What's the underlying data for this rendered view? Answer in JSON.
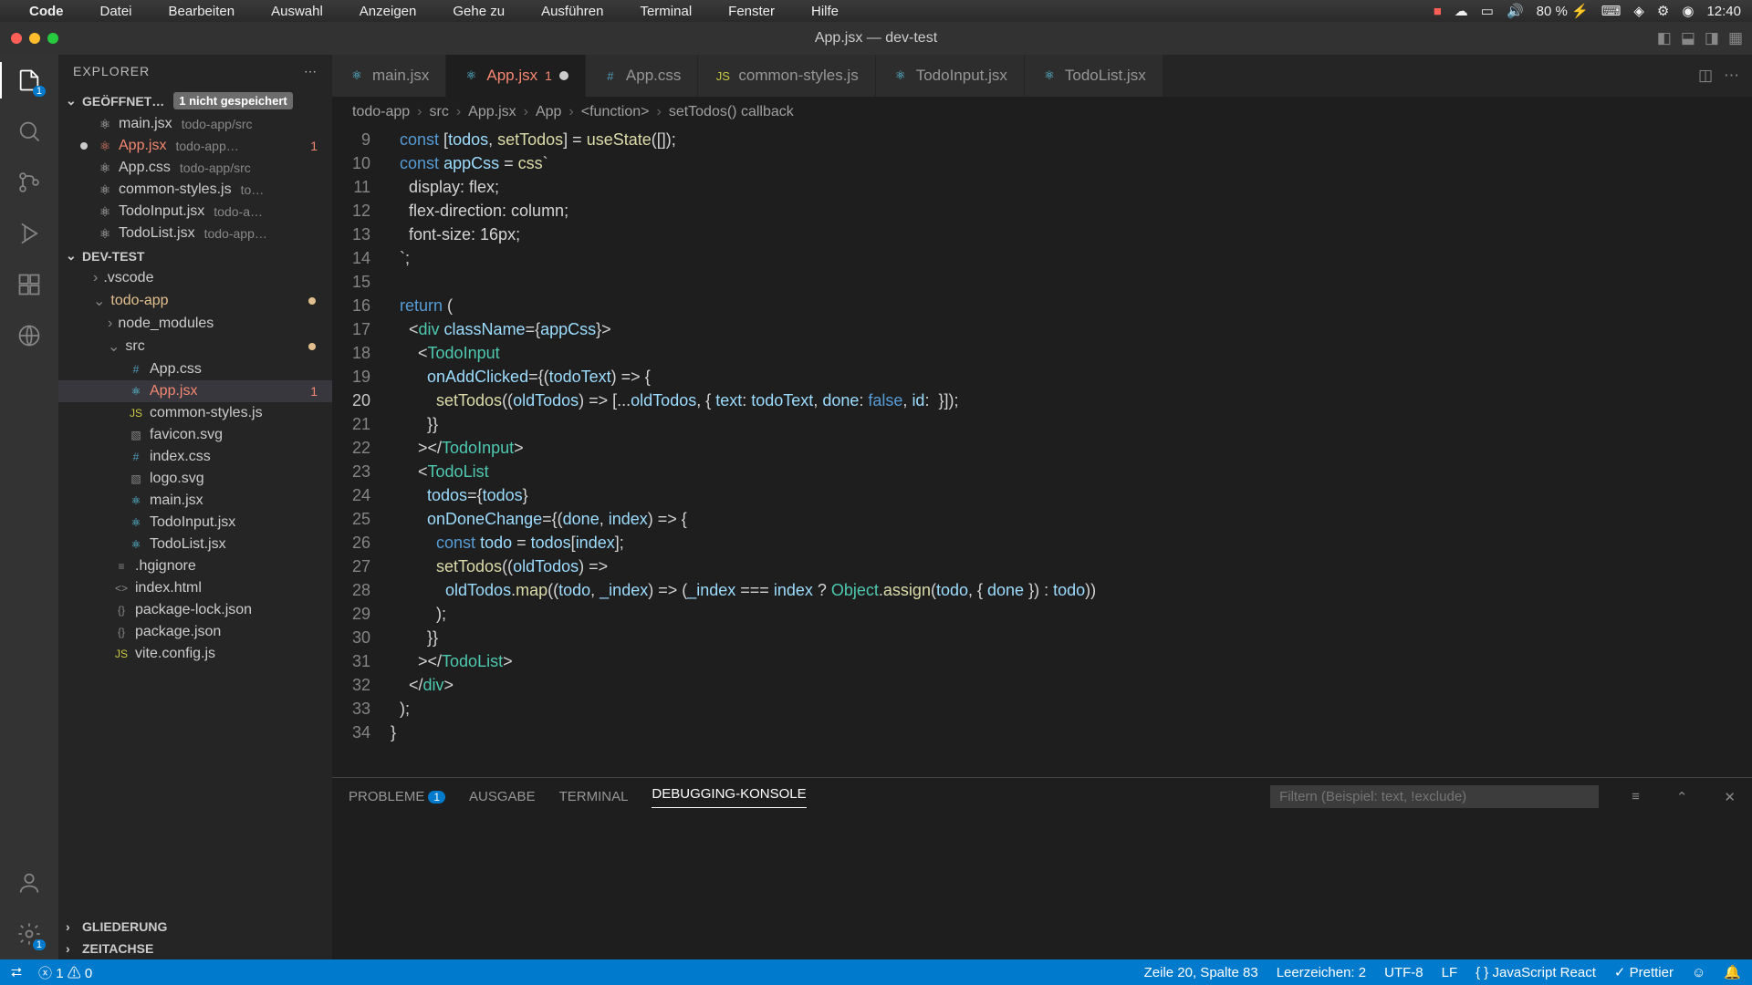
{
  "mac_menu": [
    "Code",
    "Datei",
    "Bearbeiten",
    "Auswahl",
    "Anzeigen",
    "Gehe zu",
    "Ausführen",
    "Terminal",
    "Fenster",
    "Hilfe"
  ],
  "mac_right": {
    "battery": "80 % ⚡",
    "time": "12:40"
  },
  "window_title": "App.jsx — dev-test",
  "explorer_title": "EXPLORER",
  "open_editors": {
    "label": "GEÖFFNET…",
    "unsaved": "1 nicht gespeichert"
  },
  "open_files": [
    {
      "name": "main.jsx",
      "dim": "todo-app/src"
    },
    {
      "name": "App.jsx",
      "dim": "todo-app…",
      "err": "1",
      "mod": true
    },
    {
      "name": "App.css",
      "dim": "todo-app/src"
    },
    {
      "name": "common-styles.js",
      "dim": "to…"
    },
    {
      "name": "TodoInput.jsx",
      "dim": "todo-a…"
    },
    {
      "name": "TodoList.jsx",
      "dim": "todo-app…"
    }
  ],
  "proj_name": "DEV-TEST",
  "tree": [
    {
      "n": ".vscode",
      "d": 1,
      "folder": true
    },
    {
      "n": "todo-app",
      "d": 1,
      "folder": true,
      "open": true,
      "mod": true
    },
    {
      "n": "node_modules",
      "d": 2,
      "folder": true
    },
    {
      "n": "src",
      "d": 2,
      "folder": true,
      "open": true,
      "mod": true
    },
    {
      "n": "App.css",
      "d": 3,
      "ic": "#"
    },
    {
      "n": "App.jsx",
      "d": 3,
      "ic": "⚛",
      "err": "1",
      "sel": true
    },
    {
      "n": "common-styles.js",
      "d": 3,
      "ic": "JS"
    },
    {
      "n": "favicon.svg",
      "d": 3,
      "ic": "▧"
    },
    {
      "n": "index.css",
      "d": 3,
      "ic": "#"
    },
    {
      "n": "logo.svg",
      "d": 3,
      "ic": "▧"
    },
    {
      "n": "main.jsx",
      "d": 3,
      "ic": "⚛"
    },
    {
      "n": "TodoInput.jsx",
      "d": 3,
      "ic": "⚛"
    },
    {
      "n": "TodoList.jsx",
      "d": 3,
      "ic": "⚛"
    },
    {
      "n": ".hgignore",
      "d": 2,
      "ic": "≡"
    },
    {
      "n": "index.html",
      "d": 2,
      "ic": "<>"
    },
    {
      "n": "package-lock.json",
      "d": 2,
      "ic": "{}"
    },
    {
      "n": "package.json",
      "d": 2,
      "ic": "{}"
    },
    {
      "n": "vite.config.js",
      "d": 2,
      "ic": "JS"
    }
  ],
  "outline": "GLIEDERUNG",
  "timeline": "ZEITACHSE",
  "tabs": [
    {
      "name": "main.jsx",
      "ic": "⚛"
    },
    {
      "name": "App.jsx",
      "ic": "⚛",
      "active": true,
      "err": "1",
      "mod": true
    },
    {
      "name": "App.css",
      "ic": "#"
    },
    {
      "name": "common-styles.js",
      "ic": "JS"
    },
    {
      "name": "TodoInput.jsx",
      "ic": "⚛"
    },
    {
      "name": "TodoList.jsx",
      "ic": "⚛"
    }
  ],
  "breadcrumb": [
    "todo-app",
    "src",
    "App.jsx",
    "App",
    "<function>",
    "setTodos() callback"
  ],
  "code": {
    "first_line": 9,
    "lines": [
      "  const [todos, setTodos] = useState([]);",
      "  const appCss = css`",
      "    display: flex;",
      "    flex-direction: column;",
      "    font-size: 16px;",
      "  `;",
      "",
      "  return (",
      "    <div className={appCss}>",
      "      <TodoInput",
      "        onAddClicked={(todoText) => {",
      "          setTodos((oldTodos) => [...oldTodos, { text: todoText, done: false, id:  }]);",
      "        }}",
      "      ></TodoInput>",
      "      <TodoList",
      "        todos={todos}",
      "        onDoneChange={(done, index) => {",
      "          const todo = todos[index];",
      "          setTodos((oldTodos) =>",
      "            oldTodos.map((todo, _index) => (_index === index ? Object.assign(todo, { done }) : todo))",
      "          );",
      "        }}",
      "      ></TodoList>",
      "    </div>",
      "  );",
      "}"
    ],
    "highlight_line": 20
  },
  "panel": {
    "tabs": [
      {
        "l": "PROBLEME",
        "b": "1"
      },
      {
        "l": "AUSGABE"
      },
      {
        "l": "TERMINAL"
      },
      {
        "l": "DEBUGGING-KONSOLE",
        "active": true
      }
    ],
    "filter_ph": "Filtern (Beispiel: text, !exclude)"
  },
  "status": {
    "err": "1",
    "warn": "0",
    "pos": "Zeile 20, Spalte 83",
    "spaces": "Leerzeichen: 2",
    "enc": "UTF-8",
    "eol": "LF",
    "lang": "JavaScript React",
    "prettier": "Prettier"
  }
}
